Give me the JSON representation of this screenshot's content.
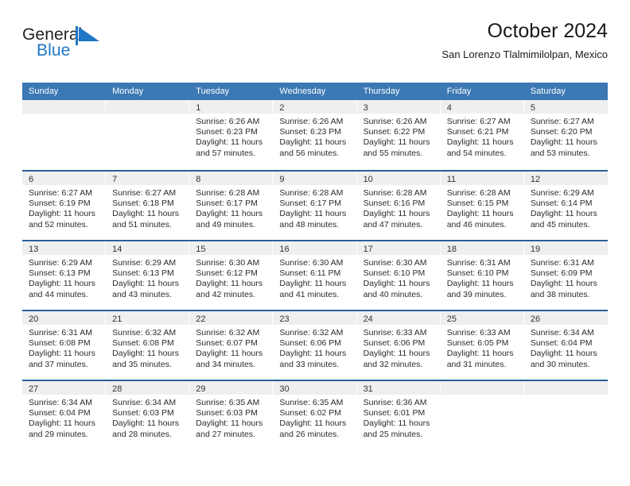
{
  "brand": {
    "name_part1": "General",
    "name_part2": "Blue",
    "flag_icon": "triangle-flag-icon",
    "accent_color": "#1f76c4"
  },
  "header": {
    "title": "October 2024",
    "subtitle": "San Lorenzo Tlalmimilolpan, Mexico"
  },
  "theme": {
    "header_band": "#3b78b4",
    "row_rule": "#2a6099",
    "daynum_strip": "#efefef"
  },
  "weekdays": [
    "Sunday",
    "Monday",
    "Tuesday",
    "Wednesday",
    "Thursday",
    "Friday",
    "Saturday"
  ],
  "labels": {
    "sunrise_prefix": "Sunrise:",
    "sunset_prefix": "Sunset:",
    "daylight_prefix": "Daylight:"
  },
  "weeks": [
    [
      {
        "day": "",
        "sunrise": "",
        "sunset": "",
        "daylight_l1": "",
        "daylight_l2": ""
      },
      {
        "day": "",
        "sunrise": "",
        "sunset": "",
        "daylight_l1": "",
        "daylight_l2": ""
      },
      {
        "day": "1",
        "sunrise": "Sunrise: 6:26 AM",
        "sunset": "Sunset: 6:23 PM",
        "daylight_l1": "Daylight: 11 hours",
        "daylight_l2": "and 57 minutes."
      },
      {
        "day": "2",
        "sunrise": "Sunrise: 6:26 AM",
        "sunset": "Sunset: 6:23 PM",
        "daylight_l1": "Daylight: 11 hours",
        "daylight_l2": "and 56 minutes."
      },
      {
        "day": "3",
        "sunrise": "Sunrise: 6:26 AM",
        "sunset": "Sunset: 6:22 PM",
        "daylight_l1": "Daylight: 11 hours",
        "daylight_l2": "and 55 minutes."
      },
      {
        "day": "4",
        "sunrise": "Sunrise: 6:27 AM",
        "sunset": "Sunset: 6:21 PM",
        "daylight_l1": "Daylight: 11 hours",
        "daylight_l2": "and 54 minutes."
      },
      {
        "day": "5",
        "sunrise": "Sunrise: 6:27 AM",
        "sunset": "Sunset: 6:20 PM",
        "daylight_l1": "Daylight: 11 hours",
        "daylight_l2": "and 53 minutes."
      }
    ],
    [
      {
        "day": "6",
        "sunrise": "Sunrise: 6:27 AM",
        "sunset": "Sunset: 6:19 PM",
        "daylight_l1": "Daylight: 11 hours",
        "daylight_l2": "and 52 minutes."
      },
      {
        "day": "7",
        "sunrise": "Sunrise: 6:27 AM",
        "sunset": "Sunset: 6:18 PM",
        "daylight_l1": "Daylight: 11 hours",
        "daylight_l2": "and 51 minutes."
      },
      {
        "day": "8",
        "sunrise": "Sunrise: 6:28 AM",
        "sunset": "Sunset: 6:17 PM",
        "daylight_l1": "Daylight: 11 hours",
        "daylight_l2": "and 49 minutes."
      },
      {
        "day": "9",
        "sunrise": "Sunrise: 6:28 AM",
        "sunset": "Sunset: 6:17 PM",
        "daylight_l1": "Daylight: 11 hours",
        "daylight_l2": "and 48 minutes."
      },
      {
        "day": "10",
        "sunrise": "Sunrise: 6:28 AM",
        "sunset": "Sunset: 6:16 PM",
        "daylight_l1": "Daylight: 11 hours",
        "daylight_l2": "and 47 minutes."
      },
      {
        "day": "11",
        "sunrise": "Sunrise: 6:28 AM",
        "sunset": "Sunset: 6:15 PM",
        "daylight_l1": "Daylight: 11 hours",
        "daylight_l2": "and 46 minutes."
      },
      {
        "day": "12",
        "sunrise": "Sunrise: 6:29 AM",
        "sunset": "Sunset: 6:14 PM",
        "daylight_l1": "Daylight: 11 hours",
        "daylight_l2": "and 45 minutes."
      }
    ],
    [
      {
        "day": "13",
        "sunrise": "Sunrise: 6:29 AM",
        "sunset": "Sunset: 6:13 PM",
        "daylight_l1": "Daylight: 11 hours",
        "daylight_l2": "and 44 minutes."
      },
      {
        "day": "14",
        "sunrise": "Sunrise: 6:29 AM",
        "sunset": "Sunset: 6:13 PM",
        "daylight_l1": "Daylight: 11 hours",
        "daylight_l2": "and 43 minutes."
      },
      {
        "day": "15",
        "sunrise": "Sunrise: 6:30 AM",
        "sunset": "Sunset: 6:12 PM",
        "daylight_l1": "Daylight: 11 hours",
        "daylight_l2": "and 42 minutes."
      },
      {
        "day": "16",
        "sunrise": "Sunrise: 6:30 AM",
        "sunset": "Sunset: 6:11 PM",
        "daylight_l1": "Daylight: 11 hours",
        "daylight_l2": "and 41 minutes."
      },
      {
        "day": "17",
        "sunrise": "Sunrise: 6:30 AM",
        "sunset": "Sunset: 6:10 PM",
        "daylight_l1": "Daylight: 11 hours",
        "daylight_l2": "and 40 minutes."
      },
      {
        "day": "18",
        "sunrise": "Sunrise: 6:31 AM",
        "sunset": "Sunset: 6:10 PM",
        "daylight_l1": "Daylight: 11 hours",
        "daylight_l2": "and 39 minutes."
      },
      {
        "day": "19",
        "sunrise": "Sunrise: 6:31 AM",
        "sunset": "Sunset: 6:09 PM",
        "daylight_l1": "Daylight: 11 hours",
        "daylight_l2": "and 38 minutes."
      }
    ],
    [
      {
        "day": "20",
        "sunrise": "Sunrise: 6:31 AM",
        "sunset": "Sunset: 6:08 PM",
        "daylight_l1": "Daylight: 11 hours",
        "daylight_l2": "and 37 minutes."
      },
      {
        "day": "21",
        "sunrise": "Sunrise: 6:32 AM",
        "sunset": "Sunset: 6:08 PM",
        "daylight_l1": "Daylight: 11 hours",
        "daylight_l2": "and 35 minutes."
      },
      {
        "day": "22",
        "sunrise": "Sunrise: 6:32 AM",
        "sunset": "Sunset: 6:07 PM",
        "daylight_l1": "Daylight: 11 hours",
        "daylight_l2": "and 34 minutes."
      },
      {
        "day": "23",
        "sunrise": "Sunrise: 6:32 AM",
        "sunset": "Sunset: 6:06 PM",
        "daylight_l1": "Daylight: 11 hours",
        "daylight_l2": "and 33 minutes."
      },
      {
        "day": "24",
        "sunrise": "Sunrise: 6:33 AM",
        "sunset": "Sunset: 6:06 PM",
        "daylight_l1": "Daylight: 11 hours",
        "daylight_l2": "and 32 minutes."
      },
      {
        "day": "25",
        "sunrise": "Sunrise: 6:33 AM",
        "sunset": "Sunset: 6:05 PM",
        "daylight_l1": "Daylight: 11 hours",
        "daylight_l2": "and 31 minutes."
      },
      {
        "day": "26",
        "sunrise": "Sunrise: 6:34 AM",
        "sunset": "Sunset: 6:04 PM",
        "daylight_l1": "Daylight: 11 hours",
        "daylight_l2": "and 30 minutes."
      }
    ],
    [
      {
        "day": "27",
        "sunrise": "Sunrise: 6:34 AM",
        "sunset": "Sunset: 6:04 PM",
        "daylight_l1": "Daylight: 11 hours",
        "daylight_l2": "and 29 minutes."
      },
      {
        "day": "28",
        "sunrise": "Sunrise: 6:34 AM",
        "sunset": "Sunset: 6:03 PM",
        "daylight_l1": "Daylight: 11 hours",
        "daylight_l2": "and 28 minutes."
      },
      {
        "day": "29",
        "sunrise": "Sunrise: 6:35 AM",
        "sunset": "Sunset: 6:03 PM",
        "daylight_l1": "Daylight: 11 hours",
        "daylight_l2": "and 27 minutes."
      },
      {
        "day": "30",
        "sunrise": "Sunrise: 6:35 AM",
        "sunset": "Sunset: 6:02 PM",
        "daylight_l1": "Daylight: 11 hours",
        "daylight_l2": "and 26 minutes."
      },
      {
        "day": "31",
        "sunrise": "Sunrise: 6:36 AM",
        "sunset": "Sunset: 6:01 PM",
        "daylight_l1": "Daylight: 11 hours",
        "daylight_l2": "and 25 minutes."
      },
      {
        "day": "",
        "sunrise": "",
        "sunset": "",
        "daylight_l1": "",
        "daylight_l2": ""
      },
      {
        "day": "",
        "sunrise": "",
        "sunset": "",
        "daylight_l1": "",
        "daylight_l2": ""
      }
    ]
  ]
}
